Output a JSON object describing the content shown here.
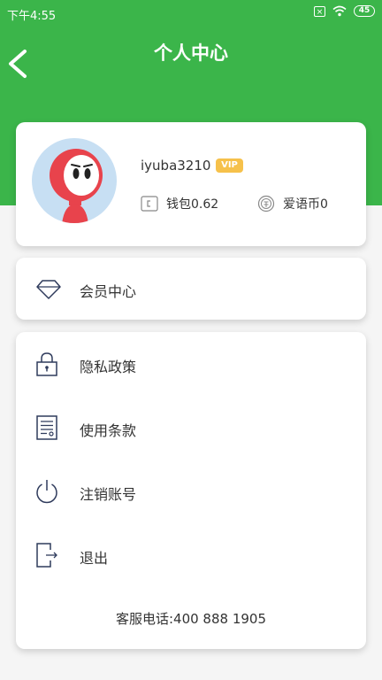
{
  "status_bar": {
    "time": "下午4:55",
    "battery": "45"
  },
  "header": {
    "title": "个人中心"
  },
  "profile": {
    "username": "iyuba3210",
    "vip_label": "VIP",
    "wallet": "钱包0.62",
    "coins": "爱语币0"
  },
  "member": {
    "label": "会员中心"
  },
  "menu": {
    "items": [
      {
        "label": "隐私政策",
        "icon": "lock-icon"
      },
      {
        "label": "使用条款",
        "icon": "document-icon"
      },
      {
        "label": "注销账号",
        "icon": "power-icon"
      },
      {
        "label": "退出",
        "icon": "logout-icon"
      }
    ],
    "hotline": "客服电话:400 888 1905"
  },
  "colors": {
    "brand_green": "#3bb54a",
    "vip_gold": "#f6c14b",
    "icon_navy": "#2f3b5c"
  }
}
